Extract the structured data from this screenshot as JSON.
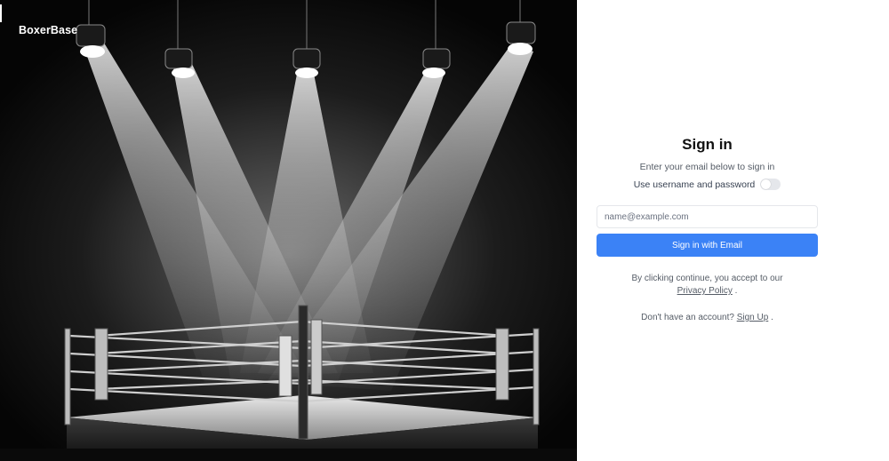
{
  "brand": {
    "name": "BoxerBase"
  },
  "signin": {
    "title": "Sign in",
    "subtitle": "Enter your email below to sign in",
    "toggle_label": "Use username and password",
    "toggle_on": false,
    "email_placeholder": "name@example.com",
    "submit_label": "Sign in with Email",
    "terms_prefix": "By clicking continue, you accept to our",
    "terms_link": "Privacy Policy",
    "terms_suffix": ".",
    "signup_prefix": "Don't have an account?",
    "signup_link": "Sign Up",
    "signup_suffix": "."
  },
  "colors": {
    "accent": "#3b82f6",
    "hero_background": "#050505"
  },
  "hero": {
    "image_description_icon": "boxing-ring-spotlights-image"
  }
}
